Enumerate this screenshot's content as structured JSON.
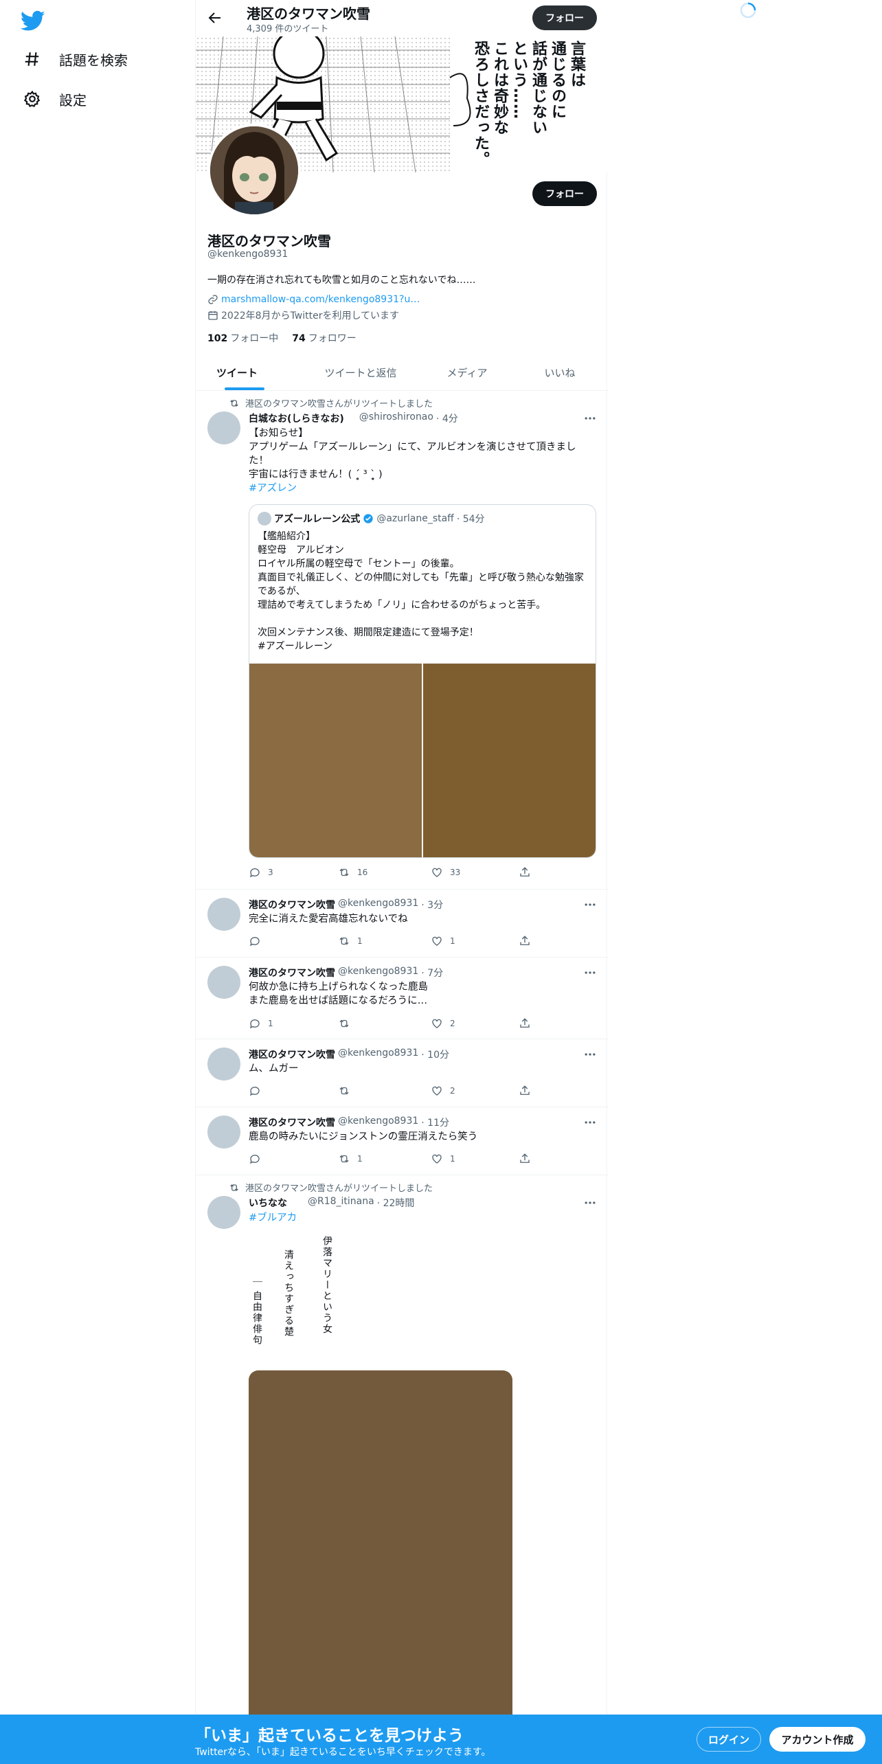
{
  "nav": {
    "explore": "話題を検索",
    "settings": "設定"
  },
  "header": {
    "name": "港区のタワマン吹雪",
    "tweet_count": "4,309 件のツイート",
    "follow": "フォロー"
  },
  "banner": {
    "lines": [
      "言葉は",
      "通じるのに",
      "話が通じない",
      "という……",
      "これは奇妙な",
      "恐ろしさだった。"
    ]
  },
  "profile": {
    "follow": "フォロー",
    "name": "港区のタワマン吹雪",
    "handle": "@kenkengo8931",
    "bio": "一期の存在消され忘れても吹雪と如月のこと忘れないでね……",
    "link": "marshmallow-qa.com/kenkengo8931?u…",
    "joined": "2022年8月からTwitterを利用しています",
    "following_count": "102",
    "following_label": "フォロー中",
    "followers_count": "74",
    "followers_label": "フォロワー"
  },
  "tabs": [
    "ツイート",
    "ツイートと返信",
    "メディア",
    "いいね"
  ],
  "tweets": [
    {
      "retweeted_by": "港区のタワマン吹雪さんがリツイートしました",
      "name": "白城なお(しらきなお)",
      "handle": "@shiroshironao",
      "time": "· 4分",
      "text": "【お知らせ】\nアプリゲーム「アズールレーン」にて、アルビオンを演じさせて頂きました！\n宇宙には行きません！( ˊ̥̥̥̥̥ ³ ˋ̥̥̥̥̥ )",
      "hashtag": "#アズレン",
      "quote": {
        "name": "アズールレーン公式",
        "handle": "@azurlane_staff",
        "time": "· 54分",
        "text": "【艦船紹介】\n軽空母　アルビオン\nロイヤル所属の軽空母で「セントー」の後輩。\n真面目で礼儀正しく、どの仲間に対しても「先輩」と呼び敬う熱心な勉強家であるが、\n理詰めで考えてしまうため「ノリ」に合わせるのがちょっと苦手。\n\n次回メンテナンス後、期間限定建造にて登場予定！\n#アズールレーン"
      },
      "replies": "3",
      "retweets": "16",
      "likes": "33"
    },
    {
      "name": "港区のタワマン吹雪",
      "handle": "@kenkengo8931",
      "time": "· 3分",
      "text": "完全に消えた愛宕高雄忘れないでね",
      "replies": "",
      "retweets": "1",
      "likes": "1"
    },
    {
      "name": "港区のタワマン吹雪",
      "handle": "@kenkengo8931",
      "time": "· 7分",
      "text": "何故か急に持ち上げられなくなった鹿島\nまた鹿島を出せば話題になるだろうに…",
      "replies": "1",
      "retweets": "",
      "likes": "2"
    },
    {
      "name": "港区のタワマン吹雪",
      "handle": "@kenkengo8931",
      "time": "· 10分",
      "text": "ム、ムガー",
      "replies": "",
      "retweets": "",
      "likes": "2"
    },
    {
      "name": "港区のタワマン吹雪",
      "handle": "@kenkengo8931",
      "time": "· 11分",
      "text": "鹿島の時みたいにジョンストンの霊圧消えたら笑う",
      "replies": "",
      "retweets": "1",
      "likes": "1"
    },
    {
      "retweeted_by": "港区のタワマン吹雪さんがリツイートしました",
      "name": "いちなな",
      "handle": "@R18_itinana",
      "time": "· 22時間",
      "hashtag": "#ブルアカ",
      "poem": [
        "伊落マリーという女",
        "清えっちすぎる楚",
        "",
        "自由律俳句"
      ]
    }
  ],
  "bottom": {
    "title": "「いま」起きていることを見つけよう",
    "subtitle": "Twitterなら、「いま」起きていることをいち早くチェックできます。",
    "login": "ログイン",
    "signup": "アカウント作成"
  },
  "colors": {
    "accent": "#1d9bf0",
    "text": "#0f1419",
    "muted": "#536471"
  }
}
